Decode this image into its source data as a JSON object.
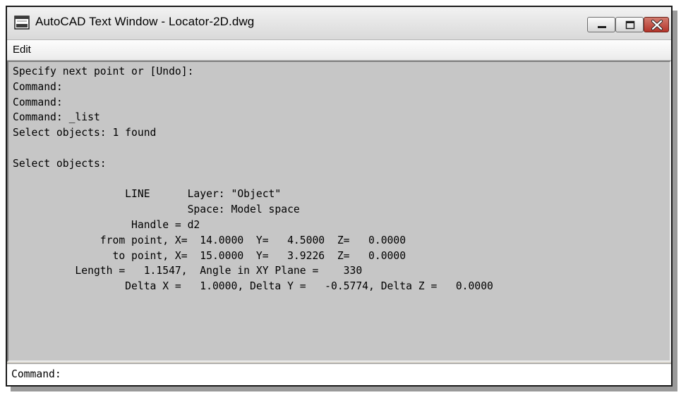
{
  "window": {
    "title": "AutoCAD Text Window - Locator-2D.dwg",
    "icon": "text-window-icon",
    "controls": [
      "minimize-icon",
      "maximize-icon",
      "close-icon"
    ]
  },
  "menu": {
    "items": [
      "Edit"
    ]
  },
  "history": {
    "lines": [
      "Specify next point or [Undo]:",
      "Command:",
      "Command:",
      "Command: _list",
      "Select objects: 1 found",
      "",
      "Select objects:",
      "",
      "                  LINE      Layer: \"Object\"",
      "                            Space: Model space",
      "                   Handle = d2",
      "              from point, X=  14.0000  Y=   4.5000  Z=   0.0000",
      "                to point, X=  15.0000  Y=   3.9226  Z=   0.0000",
      "          Length =   1.1547,  Angle in XY Plane =    330",
      "                  Delta X =   1.0000, Delta Y =   -0.5774, Delta Z =   0.0000"
    ]
  },
  "command_line": {
    "prompt": "Command:"
  }
}
